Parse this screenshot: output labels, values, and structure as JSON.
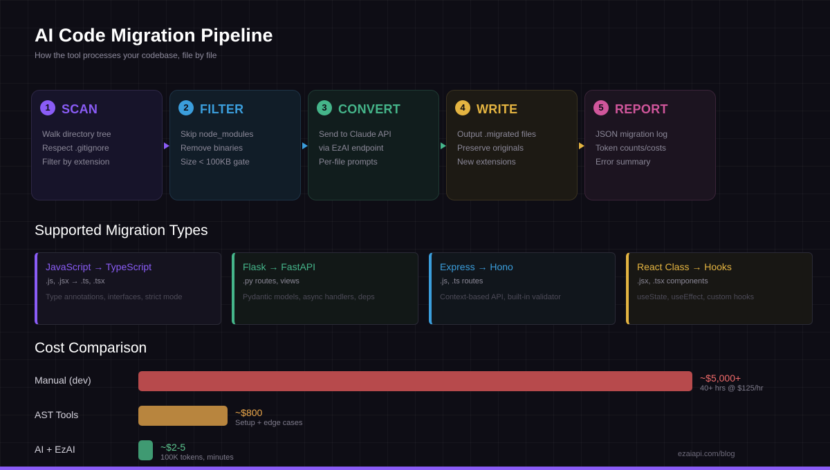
{
  "header": {
    "title": "AI Code Migration Pipeline",
    "subtitle": "How the tool processes your codebase, file by file"
  },
  "stages": [
    {
      "number": "1",
      "name": "SCAN",
      "lines": [
        "Walk directory tree",
        "Respect .gitignore",
        "Filter by extension"
      ],
      "color": "#8a5cf6"
    },
    {
      "number": "2",
      "name": "FILTER",
      "lines": [
        "Skip node_modules",
        "Remove binaries",
        "Size < 100KB gate"
      ],
      "color": "#3b9edc"
    },
    {
      "number": "3",
      "name": "CONVERT",
      "lines": [
        "Send to Claude API",
        "via EzAI endpoint",
        "Per-file prompts"
      ],
      "color": "#45b58a"
    },
    {
      "number": "4",
      "name": "WRITE",
      "lines": [
        "Output .migrated files",
        "Preserve originals",
        "New extensions"
      ],
      "color": "#e4b441"
    },
    {
      "number": "5",
      "name": "REPORT",
      "lines": [
        "JSON migration log",
        "Token counts/costs",
        "Error summary"
      ],
      "color": "#d0569b"
    }
  ],
  "migrations": {
    "title": "Supported Migration Types",
    "items": [
      {
        "title": "JavaScript → TypeScript",
        "files": ".js, .jsx → .ts, .tsx",
        "desc": "Type annotations, interfaces, strict mode",
        "color": "#8a5cf6"
      },
      {
        "title": "Flask → FastAPI",
        "files": ".py routes, views",
        "desc": "Pydantic models, async handlers, deps",
        "color": "#45b58a"
      },
      {
        "title": "Express → Hono",
        "files": ".js, .ts routes",
        "desc": "Context-based API, built-in validator",
        "color": "#3b9edc"
      },
      {
        "title": "React Class → Hooks",
        "files": ".jsx, .tsx components",
        "desc": "useState, useEffect, custom hooks",
        "color": "#e4b441"
      }
    ]
  },
  "costs": {
    "title": "Cost Comparison",
    "rows": [
      {
        "label": "Manual (dev)",
        "value": "~$5,000+",
        "note": "40+ hrs @ $125/hr",
        "color": "#b74a4c",
        "text_color": "#ef6a6a"
      },
      {
        "label": "AST Tools",
        "value": "~$800",
        "note": "Setup + edge cases",
        "color": "#b8853e",
        "text_color": "#eca84a"
      },
      {
        "label": "AI + EzAI",
        "value": "~$2-5",
        "note": "100K tokens, minutes",
        "color": "#3f9a72",
        "text_color": "#5cc890"
      }
    ]
  },
  "footer": "ezaiapi.com/blog"
}
